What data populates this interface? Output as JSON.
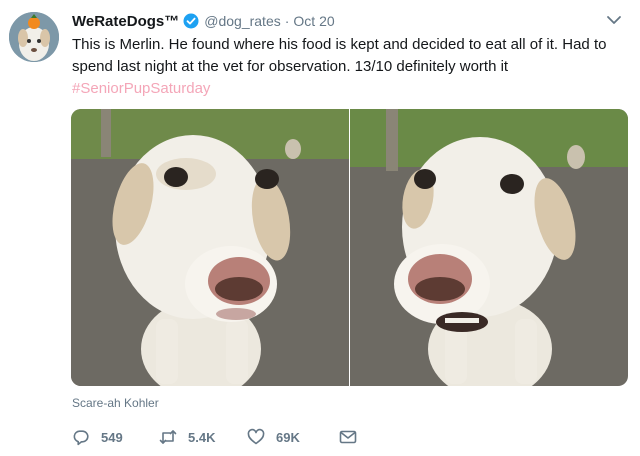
{
  "author": {
    "name": "WeRateDogs™",
    "handle": "@dog_rates",
    "separator": "·",
    "date": "Oct 20"
  },
  "tweet": {
    "text": "This is Merlin. He found where his food is kept and decided to eat all of it. Had to spend last night at the vet for observation. 13/10 definitely worth it",
    "hashtag": "#SeniorPupSaturday"
  },
  "media": {
    "photo_credit": "Scare-ah Kohler"
  },
  "actions": {
    "replies": "549",
    "retweets": "5.4K",
    "likes": "69K"
  },
  "colors": {
    "hashtag": "#f4a6b8",
    "secondary_text": "#657786",
    "verified_badge": "#1da1f2"
  },
  "icons": [
    "avatar",
    "verified-badge-icon",
    "chevron-down-icon",
    "reply-icon",
    "retweet-icon",
    "like-icon",
    "direct-message-icon"
  ]
}
